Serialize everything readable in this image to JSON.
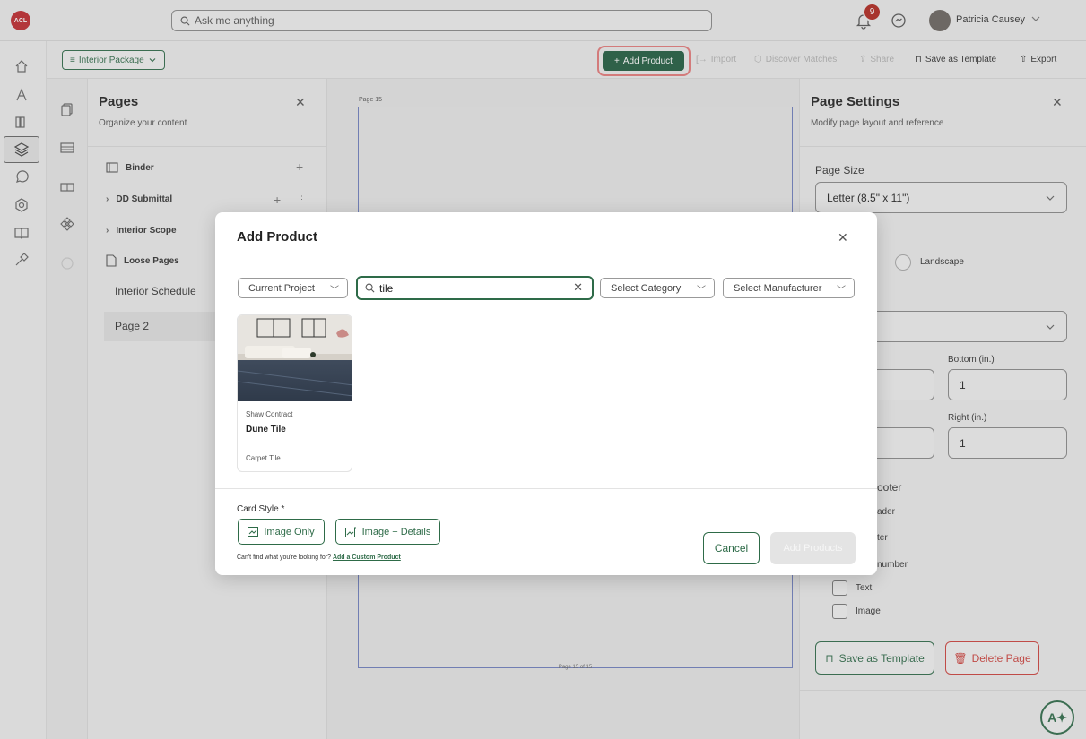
{
  "topbar": {
    "logo_text": "ACL",
    "search_placeholder": "Ask me anything",
    "notifications_count": "9",
    "user_name": "Patricia Causey"
  },
  "toolbar": {
    "package_label": "Interior Package",
    "add_product": "Add Product",
    "import": "Import",
    "discover_matches": "Discover Matches",
    "share": "Share",
    "save_as_template": "Save as Template",
    "export": "Export"
  },
  "pages_panel": {
    "title": "Pages",
    "subtitle": "Organize your content",
    "items": [
      {
        "label": "Binder"
      },
      {
        "label": "DD Submittal"
      },
      {
        "label": "Interior Scope"
      },
      {
        "label": "Loose Pages"
      },
      {
        "label": "Interior Schedule"
      },
      {
        "label": "Page 2"
      }
    ]
  },
  "canvas": {
    "page_label": "Page 15",
    "page_footer": "Page 15 of 15"
  },
  "settings": {
    "title": "Page Settings",
    "subtitle": "Modify page layout and reference",
    "page_size_label": "Page Size",
    "page_size_value": "Letter (8.5\" x 11\")",
    "landscape": "Landscape",
    "bottom_label": "Bottom (in.)",
    "bottom_value": "1",
    "right_label": "Right (in.)",
    "right_value": "1",
    "footer_label": "ooter",
    "header_partial": "ader",
    "footer_partial": "ter",
    "number_partial": "number",
    "text_option": "Text",
    "image_option": "Image",
    "save_template": "Save as Template",
    "delete_page": "Delete Page"
  },
  "modal": {
    "title": "Add Product",
    "filter_project": "Current Project",
    "search_value": "tile",
    "filter_category": "Select Category",
    "filter_manufacturer": "Select Manufacturer",
    "products": [
      {
        "manufacturer": "Shaw Contract",
        "name": "Dune Tile",
        "category": "Carpet Tile"
      }
    ],
    "card_style_label": "Card Style *",
    "style_image_only": "Image Only",
    "style_image_details": "Image + Details",
    "cant_find": "Can't find what you're looking for?",
    "add_custom": "Add a Custom Product",
    "cancel": "Cancel",
    "add_products": "Add Products"
  },
  "colors": {
    "brand_green": "#1f5c3f",
    "danger_red": "#d0413c",
    "badge_red": "#b3261e",
    "highlight": "#e77c7c"
  }
}
